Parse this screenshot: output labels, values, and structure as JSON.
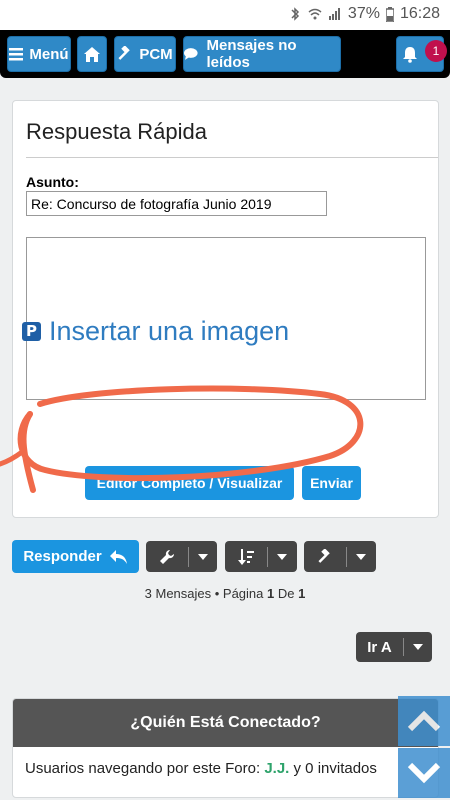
{
  "status_bar": {
    "battery": "37%",
    "time": "16:28"
  },
  "nav": {
    "menu_label": "Menú",
    "pcm_label": "PCM",
    "unread_label": "Mensajes no leídos",
    "notification_count": "1"
  },
  "quick_reply": {
    "title": "Respuesta Rápida",
    "subject_label": "Asunto:",
    "subject_value": "Re: Concurso de fotografía Junio 2019",
    "message_value": "",
    "insert_image_label": "Insertar una imagen",
    "full_editor_label": "Editor Completo / Visualizar",
    "send_label": "Enviar"
  },
  "actions": {
    "reply_label": "Responder",
    "goto_label": "Ir A"
  },
  "pagination": {
    "messages_text": "3 Mensajes • Página ",
    "current_page": "1",
    "of_text": " De ",
    "total_pages": "1"
  },
  "online": {
    "title": "¿Quién Está Conectado?",
    "text_before": "Usuarios navegando por este Foro: ",
    "user": "J.J.",
    "text_after": " y 0 invitados"
  },
  "colors": {
    "accent": "#1b95e0",
    "nav_button": "#2f89c7",
    "badge": "#c0104d",
    "annotation": "#f06a4a"
  }
}
